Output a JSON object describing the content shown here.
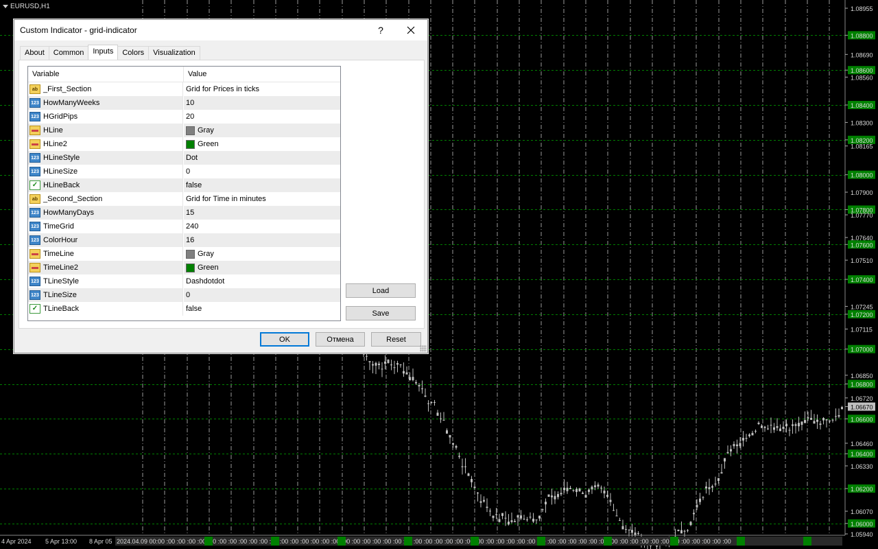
{
  "chart": {
    "symbol": "EURUSD,H1",
    "price_labels": [
      "1.08955",
      "1.08800",
      "1.08690",
      "1.08600",
      "1.08560",
      "1.08400",
      "1.08300",
      "1.08200",
      "1.08165",
      "1.08000",
      "1.07900",
      "1.07800",
      "1.07770",
      "1.07640",
      "1.07600",
      "1.07510",
      "1.07400",
      "1.07245",
      "1.07200",
      "1.07115",
      "1.07000",
      "1.06850",
      "1.06800",
      "1.06720",
      "1.06670",
      "1.06600",
      "1.06460",
      "1.06400",
      "1.06330",
      "1.06200",
      "1.06070",
      "1.06000",
      "1.05940"
    ],
    "highlighted_prices": [
      "1.08800",
      "1.08600",
      "1.08400",
      "1.08200",
      "1.08000",
      "1.07800",
      "1.07600",
      "1.07400",
      "1.07200",
      "1.07000",
      "1.06800",
      "1.06600",
      "1.06400",
      "1.06200",
      "1.06000"
    ],
    "current_price": "1.06670",
    "time_labels": [
      "4 Apr 2024",
      "5 Apr 13:00",
      "8 Apr 05",
      "2024.04.09 00:00 :00 :00 :00 :00 :00 :00 :00 :00 :00 :00 :00 :00 :00 :00 :00 :00 :00 :00 :00 :00 :00 :00 :00 :00 :00 :00 :00 :00 :00 :00 :00 :00 :00 :00 :00 :00 :00 :00 :00 :00 :00 :00 :00 :00 :00 :00 :00 :00 :00 :00 :00 :00 :00 :00 :00"
    ],
    "colors": {
      "background": "#000000",
      "grid_h": "#008000",
      "grid_v": "#808080",
      "candle": "#c0c0c0",
      "highlight": "#008000"
    }
  },
  "dialog": {
    "title": "Custom Indicator - grid-indicator",
    "help_label": "?",
    "close_label": "✕",
    "tabs": [
      "About",
      "Common",
      "Inputs",
      "Colors",
      "Visualization"
    ],
    "active_tab": "Inputs",
    "columns": {
      "variable": "Variable",
      "value": "Value"
    },
    "rows": [
      {
        "icon": "string",
        "name": "_First_Section",
        "value": "Grid for Prices in ticks"
      },
      {
        "icon": "int",
        "name": "HowManyWeeks",
        "value": "10"
      },
      {
        "icon": "int",
        "name": "HGridPips",
        "value": "20"
      },
      {
        "icon": "color",
        "name": "HLine",
        "value": "Gray",
        "swatch": "#808080"
      },
      {
        "icon": "color",
        "name": "HLine2",
        "value": "Green",
        "swatch": "#008000"
      },
      {
        "icon": "int",
        "name": "HLineStyle",
        "value": "Dot"
      },
      {
        "icon": "int",
        "name": "HLineSize",
        "value": "0"
      },
      {
        "icon": "bool",
        "name": "HLineBack",
        "value": "false"
      },
      {
        "icon": "string",
        "name": "_Second_Section",
        "value": "Grid for Time in minutes"
      },
      {
        "icon": "int",
        "name": "HowManyDays",
        "value": "15"
      },
      {
        "icon": "int",
        "name": "TimeGrid",
        "value": "240"
      },
      {
        "icon": "int",
        "name": "ColorHour",
        "value": "16"
      },
      {
        "icon": "color",
        "name": "TimeLine",
        "value": "Gray",
        "swatch": "#808080"
      },
      {
        "icon": "color",
        "name": "TimeLine2",
        "value": "Green",
        "swatch": "#008000"
      },
      {
        "icon": "int",
        "name": "TLineStyle",
        "value": "Dashdotdot"
      },
      {
        "icon": "int",
        "name": "TLineSize",
        "value": "0"
      },
      {
        "icon": "bool",
        "name": "TLineBack",
        "value": "false"
      }
    ],
    "buttons": {
      "load": "Load",
      "save": "Save",
      "ok": "OK",
      "cancel": "Отмена",
      "reset": "Reset"
    }
  }
}
